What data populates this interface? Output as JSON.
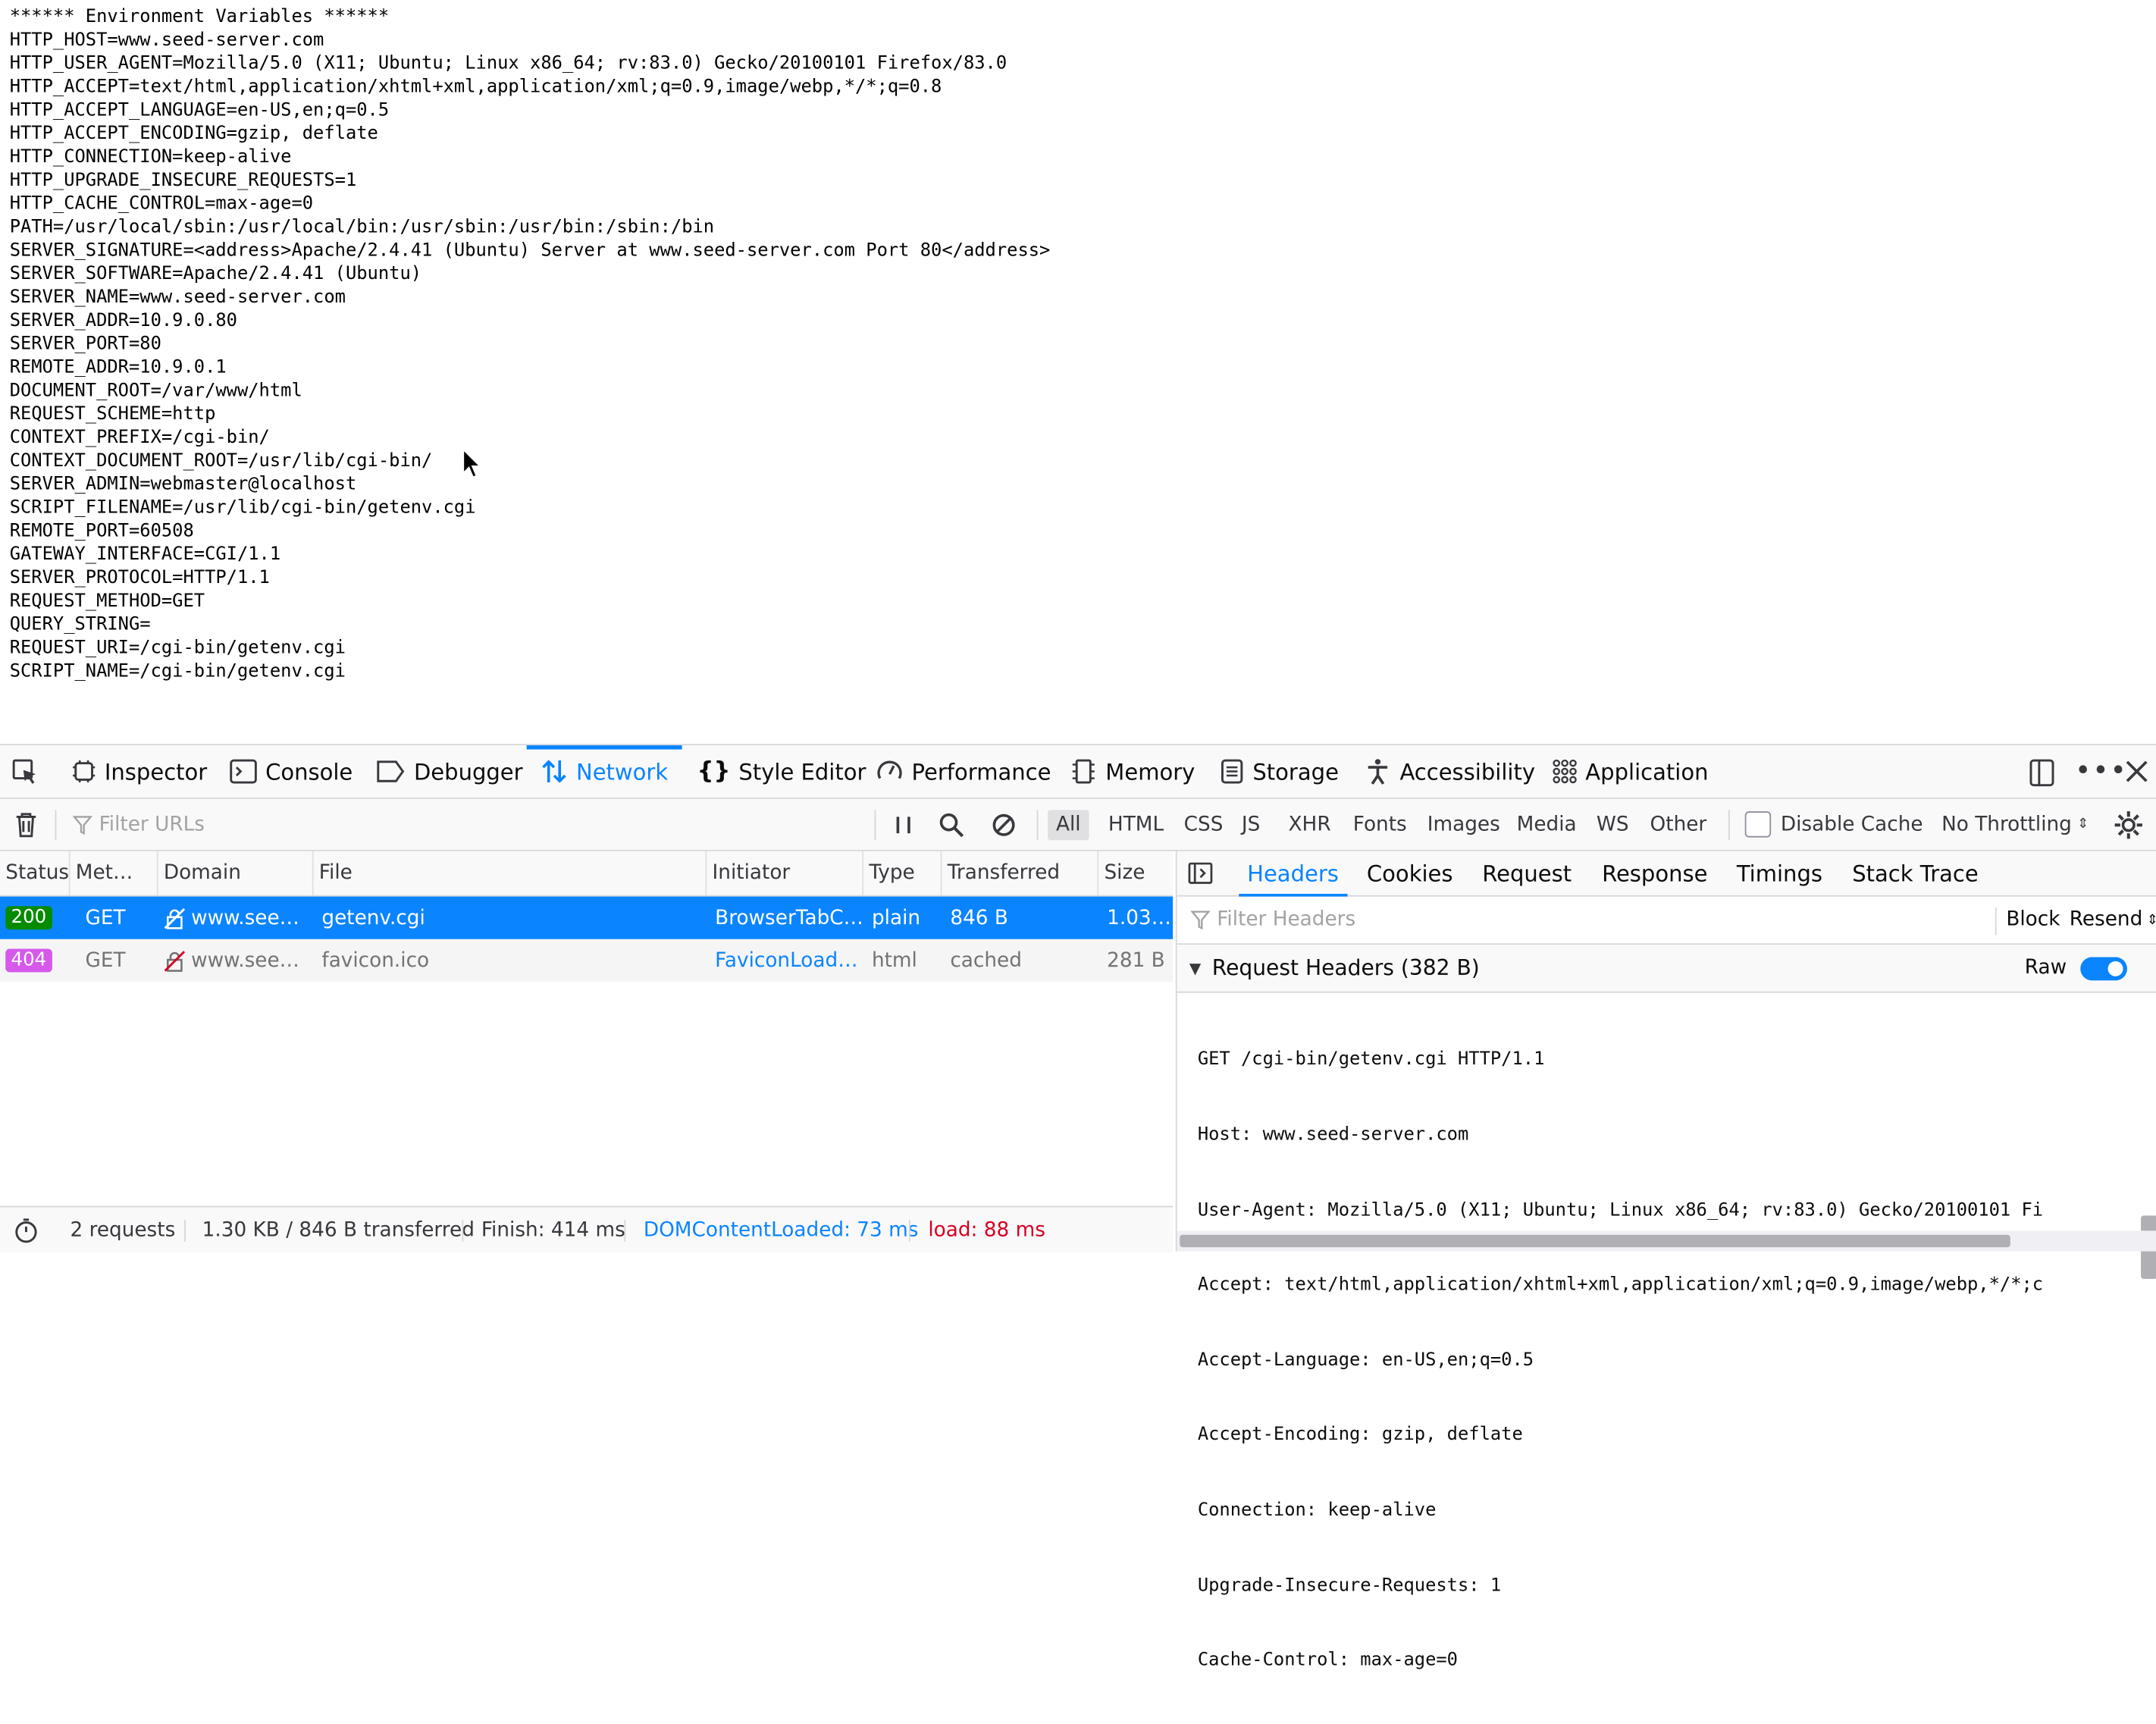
{
  "page": {
    "lines": [
      "****** Environment Variables ******",
      "HTTP_HOST=www.seed-server.com",
      "HTTP_USER_AGENT=Mozilla/5.0 (X11; Ubuntu; Linux x86_64; rv:83.0) Gecko/20100101 Firefox/83.0",
      "HTTP_ACCEPT=text/html,application/xhtml+xml,application/xml;q=0.9,image/webp,*/*;q=0.8",
      "HTTP_ACCEPT_LANGUAGE=en-US,en;q=0.5",
      "HTTP_ACCEPT_ENCODING=gzip, deflate",
      "HTTP_CONNECTION=keep-alive",
      "HTTP_UPGRADE_INSECURE_REQUESTS=1",
      "HTTP_CACHE_CONTROL=max-age=0",
      "PATH=/usr/local/sbin:/usr/local/bin:/usr/sbin:/usr/bin:/sbin:/bin",
      "SERVER_SIGNATURE=<address>Apache/2.4.41 (Ubuntu) Server at www.seed-server.com Port 80</address>",
      "SERVER_SOFTWARE=Apache/2.4.41 (Ubuntu)",
      "SERVER_NAME=www.seed-server.com",
      "SERVER_ADDR=10.9.0.80",
      "SERVER_PORT=80",
      "REMOTE_ADDR=10.9.0.1",
      "DOCUMENT_ROOT=/var/www/html",
      "REQUEST_SCHEME=http",
      "CONTEXT_PREFIX=/cgi-bin/",
      "CONTEXT_DOCUMENT_ROOT=/usr/lib/cgi-bin/",
      "SERVER_ADMIN=webmaster@localhost",
      "SCRIPT_FILENAME=/usr/lib/cgi-bin/getenv.cgi",
      "REMOTE_PORT=60508",
      "GATEWAY_INTERFACE=CGI/1.1",
      "SERVER_PROTOCOL=HTTP/1.1",
      "REQUEST_METHOD=GET",
      "QUERY_STRING=",
      "REQUEST_URI=/cgi-bin/getenv.cgi",
      "SCRIPT_NAME=/cgi-bin/getenv.cgi"
    ]
  },
  "devtools": {
    "tabs": [
      "Inspector",
      "Console",
      "Debugger",
      "Network",
      "Style Editor",
      "Performance",
      "Memory",
      "Storage",
      "Accessibility",
      "Application"
    ],
    "active_tab": "Network",
    "toolbar": {
      "filter_placeholder": "Filter URLs",
      "types": [
        "All",
        "HTML",
        "CSS",
        "JS",
        "XHR",
        "Fonts",
        "Images",
        "Media",
        "WS",
        "Other"
      ],
      "active_type": "All",
      "disable_cache": "Disable Cache",
      "throttling": "No Throttling"
    },
    "columns": [
      "Status",
      "Met…",
      "Domain",
      "File",
      "Initiator",
      "Type",
      "Transferred",
      "Size"
    ],
    "requests": [
      {
        "status": "200",
        "method": "GET",
        "domain": "www.see…",
        "file": "getenv.cgi",
        "initiator": "BrowserTabC…",
        "type": "plain",
        "transferred": "846 B",
        "size": "1.03…"
      },
      {
        "status": "404",
        "method": "GET",
        "domain": "www.see…",
        "file": "favicon.ico",
        "initiator": "FaviconLoad…",
        "type": "html",
        "transferred": "cached",
        "size": "281 B"
      }
    ],
    "status_bar": {
      "requests": "2 requests",
      "transferred": "1.30 KB / 846 B transferred",
      "finish": "Finish: 414 ms",
      "dcl": "DOMContentLoaded: 73 ms",
      "load": "load: 88 ms"
    },
    "details": {
      "tabs": [
        "Headers",
        "Cookies",
        "Request",
        "Response",
        "Timings",
        "Stack Trace"
      ],
      "active_tab": "Headers",
      "filter_placeholder": "Filter Headers",
      "block": "Block",
      "resend": "Resend",
      "section_title": "Request Headers (382 B)",
      "raw_label": "Raw",
      "raw_lines": [
        "GET /cgi-bin/getenv.cgi HTTP/1.1",
        "Host: www.seed-server.com",
        "User-Agent: Mozilla/5.0 (X11; Ubuntu; Linux x86_64; rv:83.0) Gecko/20100101 Fi",
        "Accept: text/html,application/xhtml+xml,application/xml;q=0.9,image/webp,*/*;c",
        "Accept-Language: en-US,en;q=0.5",
        "Accept-Encoding: gzip, deflate",
        "Connection: keep-alive",
        "Upgrade-Insecure-Requests: 1",
        "Cache-Control: max-age=0"
      ]
    }
  },
  "colors": {
    "accent": "#0a84ff",
    "status_ok": "#058b00",
    "status_notfound": "#d659ec",
    "dcl": "#0a84ff",
    "load": "#d70022"
  }
}
